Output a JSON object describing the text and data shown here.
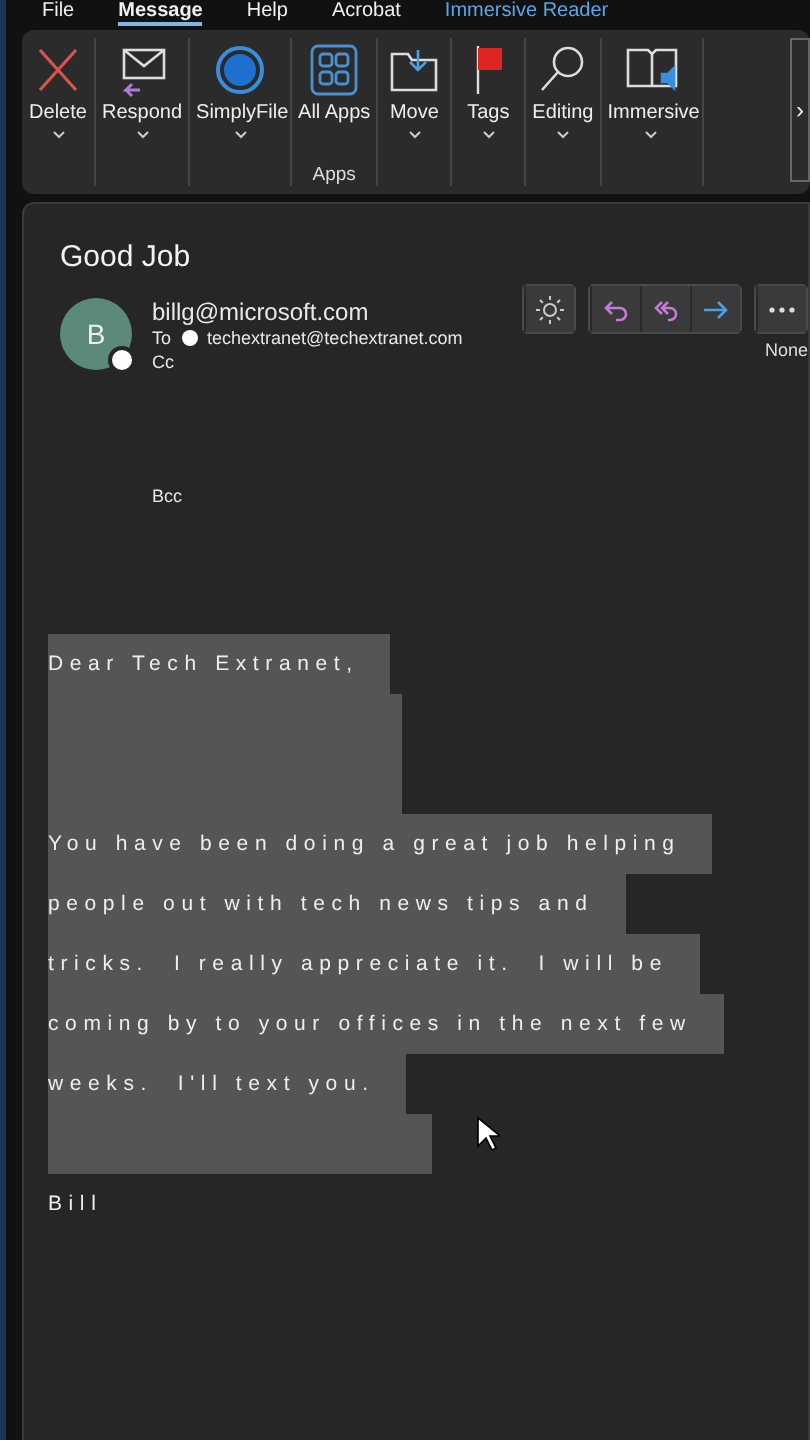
{
  "menu_tabs": [
    {
      "label": "File",
      "selected": false,
      "kind": "normal"
    },
    {
      "label": "Message",
      "selected": true,
      "kind": "normal"
    },
    {
      "label": "Help",
      "selected": false,
      "kind": "normal"
    },
    {
      "label": "Acrobat",
      "selected": false,
      "kind": "normal"
    },
    {
      "label": "Immersive Reader",
      "selected": false,
      "kind": "contextual"
    }
  ],
  "ribbon": {
    "groups": [
      {
        "buttons": [
          {
            "label": "Delete",
            "kind": "delete",
            "dropdown": true
          }
        ]
      },
      {
        "buttons": [
          {
            "label": "Respond",
            "kind": "respond",
            "dropdown": true
          }
        ]
      },
      {
        "buttons": [
          {
            "label": "SimplyFile",
            "kind": "simplyfile",
            "dropdown": true
          }
        ]
      },
      {
        "label": "Apps",
        "buttons": [
          {
            "label": "All Apps",
            "kind": "apps",
            "dropdown": false
          }
        ]
      },
      {
        "buttons": [
          {
            "label": "Move",
            "kind": "move",
            "dropdown": true
          }
        ]
      },
      {
        "buttons": [
          {
            "label": "Tags",
            "kind": "tags",
            "dropdown": true
          }
        ]
      },
      {
        "buttons": [
          {
            "label": "Editing",
            "kind": "editing",
            "dropdown": true
          }
        ]
      },
      {
        "buttons": [
          {
            "label": "Immersive",
            "kind": "immersive",
            "dropdown": true
          }
        ]
      }
    ],
    "more": "›"
  },
  "message": {
    "subject": "Good Job",
    "sender": {
      "initial": "B",
      "email": "billg@microsoft.com"
    },
    "to_label": "To",
    "to": "techextranet@techextranet.com",
    "cc_label": "Cc",
    "bcc_label": "Bcc",
    "actions": [
      {
        "kind": "brightness"
      },
      {
        "kind": "reply"
      },
      {
        "kind": "reply_all"
      },
      {
        "kind": "forward"
      },
      {
        "kind": "more"
      }
    ],
    "retention": "None",
    "body": [
      {
        "lines": [
          {
            "text": "Dear Tech Extranet,",
            "selected": true
          }
        ],
        "trailing_blank_selected": true
      },
      {
        "lines": [
          {
            "text": "You have been doing a great job helping",
            "selected": true
          },
          {
            "text": "people out with tech news tips and",
            "selected": true
          },
          {
            "text": "tricks.  I really appreciate it.  I will be",
            "selected": true
          },
          {
            "text": "coming by to your offices in the next few",
            "selected": true
          },
          {
            "text": "weeks.  I'll text you.",
            "selected": true
          }
        ],
        "trailing_blank_selected": true
      },
      {
        "lines": [
          {
            "text": "Bill",
            "selected": false
          }
        ]
      }
    ]
  }
}
